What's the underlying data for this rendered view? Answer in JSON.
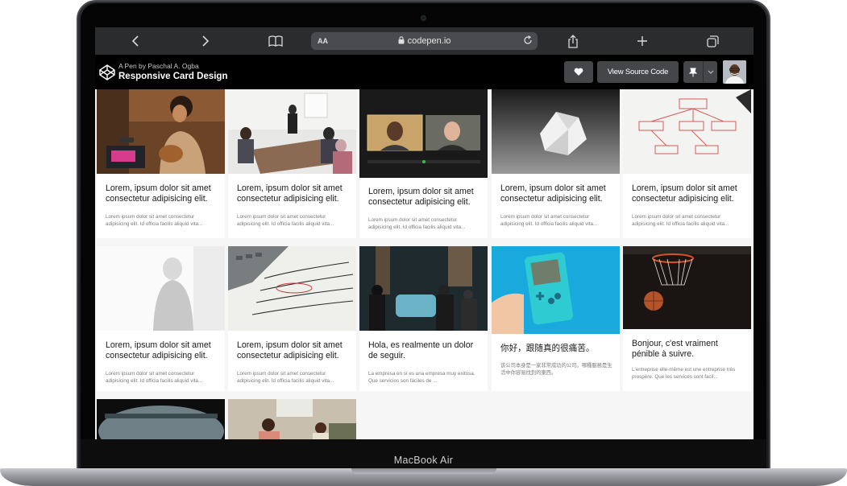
{
  "device": {
    "brand_label": "MacBook Air"
  },
  "browser": {
    "text_size_label": "AA",
    "url": "codepen.io",
    "icons": [
      "chevron-left-icon",
      "chevron-right-icon",
      "book-icon",
      "lock-icon",
      "reload-icon",
      "share-icon",
      "plus-icon",
      "tabs-icon"
    ]
  },
  "codepen": {
    "byline": "A Pen by Paschal A. Ogba",
    "title": "Responsive Card Design",
    "view_source_label": "View Source Code",
    "icons": [
      "codepen-logo-icon",
      "heart-icon",
      "pin-icon",
      "chevron-down-icon"
    ]
  },
  "cards": [
    {
      "image": "woman-headphones-guitar-photo",
      "title": "Lorem, ipsum dolor sit amet consectetur adipisicing elit.",
      "text": "Lorem ipsum dolor sit amet consectetur adipisicing elit. Id officia facilis aliquid vita..."
    },
    {
      "image": "office-meeting-photo",
      "title": "Lorem, ipsum dolor sit amet consectetur adipisicing elit.",
      "text": "Lorem ipsum dolor sit amet consectetur adipisicing elit. Id officia facilis aliquid vita..."
    },
    {
      "image": "video-call-photo",
      "title": "Lorem, ipsum dolor sit amet consectetur adipisicing elit.",
      "text": "Lorem ipsum dolor sit amet consectetur adipisicing elit. Id officia facilis aliquid vita..."
    },
    {
      "image": "crumpled-paper-photo",
      "title": "Lorem, ipsum dolor sit amet consectetur adipisicing elit.",
      "text": "Lorem ipsum dolor sit amet consectetur adipisicing elit. Id officia facilis aliquid vita..."
    },
    {
      "image": "whiteboard-flowchart-photo",
      "title": "Lorem, ipsum dolor sit amet consectetur adipisicing elit.",
      "text": "Lorem ipsum dolor sit amet consectetur adipisicing elit. Id officia facilis aliquid vita..."
    },
    {
      "image": "statue-bust-photo",
      "title": "Lorem, ipsum dolor sit amet consectetur adipisicing elit.",
      "text": "Lorem ipsum dolor sit amet consectetur adipisicing elit. Id officia facilis aliquid vita..."
    },
    {
      "image": "calculator-document-photo",
      "title": "Lorem, ipsum dolor sit amet consectetur adipisicing elit.",
      "text": "Lorem ipsum dolor sit amet consectetur adipisicing elit. Id officia facilis aliquid vita..."
    },
    {
      "image": "street-crowd-photo",
      "title": "Hola, es realmente un dolor de seguir.",
      "text": "La empresa en sí es una empresa muy exitosa. Que servicios son fáciles de ..."
    },
    {
      "image": "game-boy-photo",
      "title": "你好，跟随真的很痛苦。",
      "text": "该公司本身是一家非常成功的公司。哪種服務是生活中你容易找到的東西。"
    },
    {
      "image": "basketball-hoop-photo",
      "title": "Bonjour, c'est vraiment pénible à suivre.",
      "text": "L'entreprise elle-même est une entreprise très prospère. Que les services sont facil..."
    },
    {
      "image": "harbor-view-photo",
      "title": "",
      "text": ""
    },
    {
      "image": "family-reading-photo",
      "title": "",
      "text": ""
    }
  ]
}
